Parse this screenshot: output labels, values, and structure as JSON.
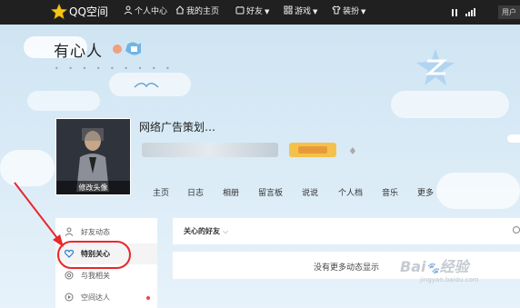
{
  "topbar": {
    "logo_text": "QQ空间",
    "items": [
      {
        "label": "个人中心",
        "icon": "person-icon"
      },
      {
        "label": "我的主页",
        "icon": "home-icon"
      },
      {
        "label": "好友",
        "icon": "friends-icon"
      },
      {
        "label": "游戏",
        "icon": "grid-icon"
      },
      {
        "label": "装扮",
        "icon": "shirt-icon"
      }
    ],
    "user_button": "用户"
  },
  "profile": {
    "space_title": "有心人",
    "name": "网络广告策划…",
    "avatar_caption": "修改头像"
  },
  "tabs": [
    "主页",
    "日志",
    "相册",
    "留言板",
    "说说",
    "个人档",
    "音乐",
    "更多"
  ],
  "sidebar": {
    "items": [
      {
        "label": "好友动态",
        "icon": "person-outline-icon"
      },
      {
        "label": "特别关心",
        "icon": "heart-icon"
      },
      {
        "label": "与我相关",
        "icon": "at-icon"
      },
      {
        "label": "空间达人",
        "icon": "play-icon"
      }
    ]
  },
  "feed": {
    "filter_label": "关心的好友",
    "empty_text": "没有更多动态显示"
  },
  "watermark": {
    "main": "Bai 经验",
    "sub": "jingyan.baidu.com"
  },
  "colors": {
    "accent_red": "#e8272b",
    "topbar": "#202020",
    "badge_yellow": "#f4c24a"
  }
}
